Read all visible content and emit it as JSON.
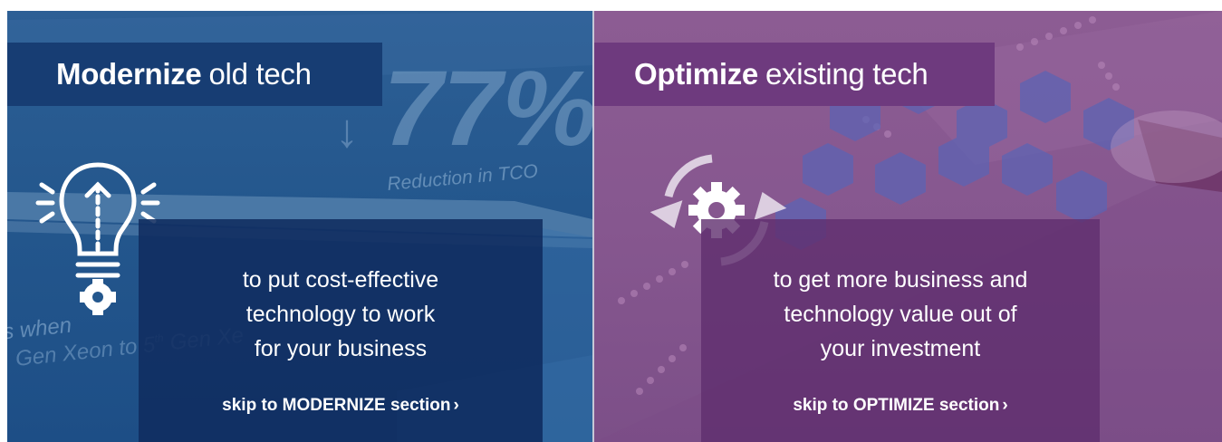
{
  "modernize": {
    "title_bold": "Modernize",
    "title_rest": "old tech",
    "body": "to put cost-effective\ntechnology to work\nfor your business",
    "link": "skip to MODERNIZE section",
    "chevron": "›",
    "background_stat": "77%",
    "background_stat_label": "Reduction in TCO",
    "background_text_1": "s when",
    "background_text_2": "Gen Xeon to 5th Gen Xe",
    "icon": "lightbulb-gear-icon"
  },
  "optimize": {
    "title_bold": "Optimize",
    "title_rest": "existing tech",
    "body": "to get more business and\ntechnology value out of\nyour investment",
    "link": "skip to OPTIMIZE section",
    "chevron": "›",
    "icon": "gear-refresh-icon"
  },
  "colors": {
    "modernize_bg": "#24578d",
    "modernize_title_bar": "#173d73",
    "optimize_bg": "#86578f",
    "optimize_title_bar": "#6e3a7e",
    "text": "#ffffff"
  }
}
